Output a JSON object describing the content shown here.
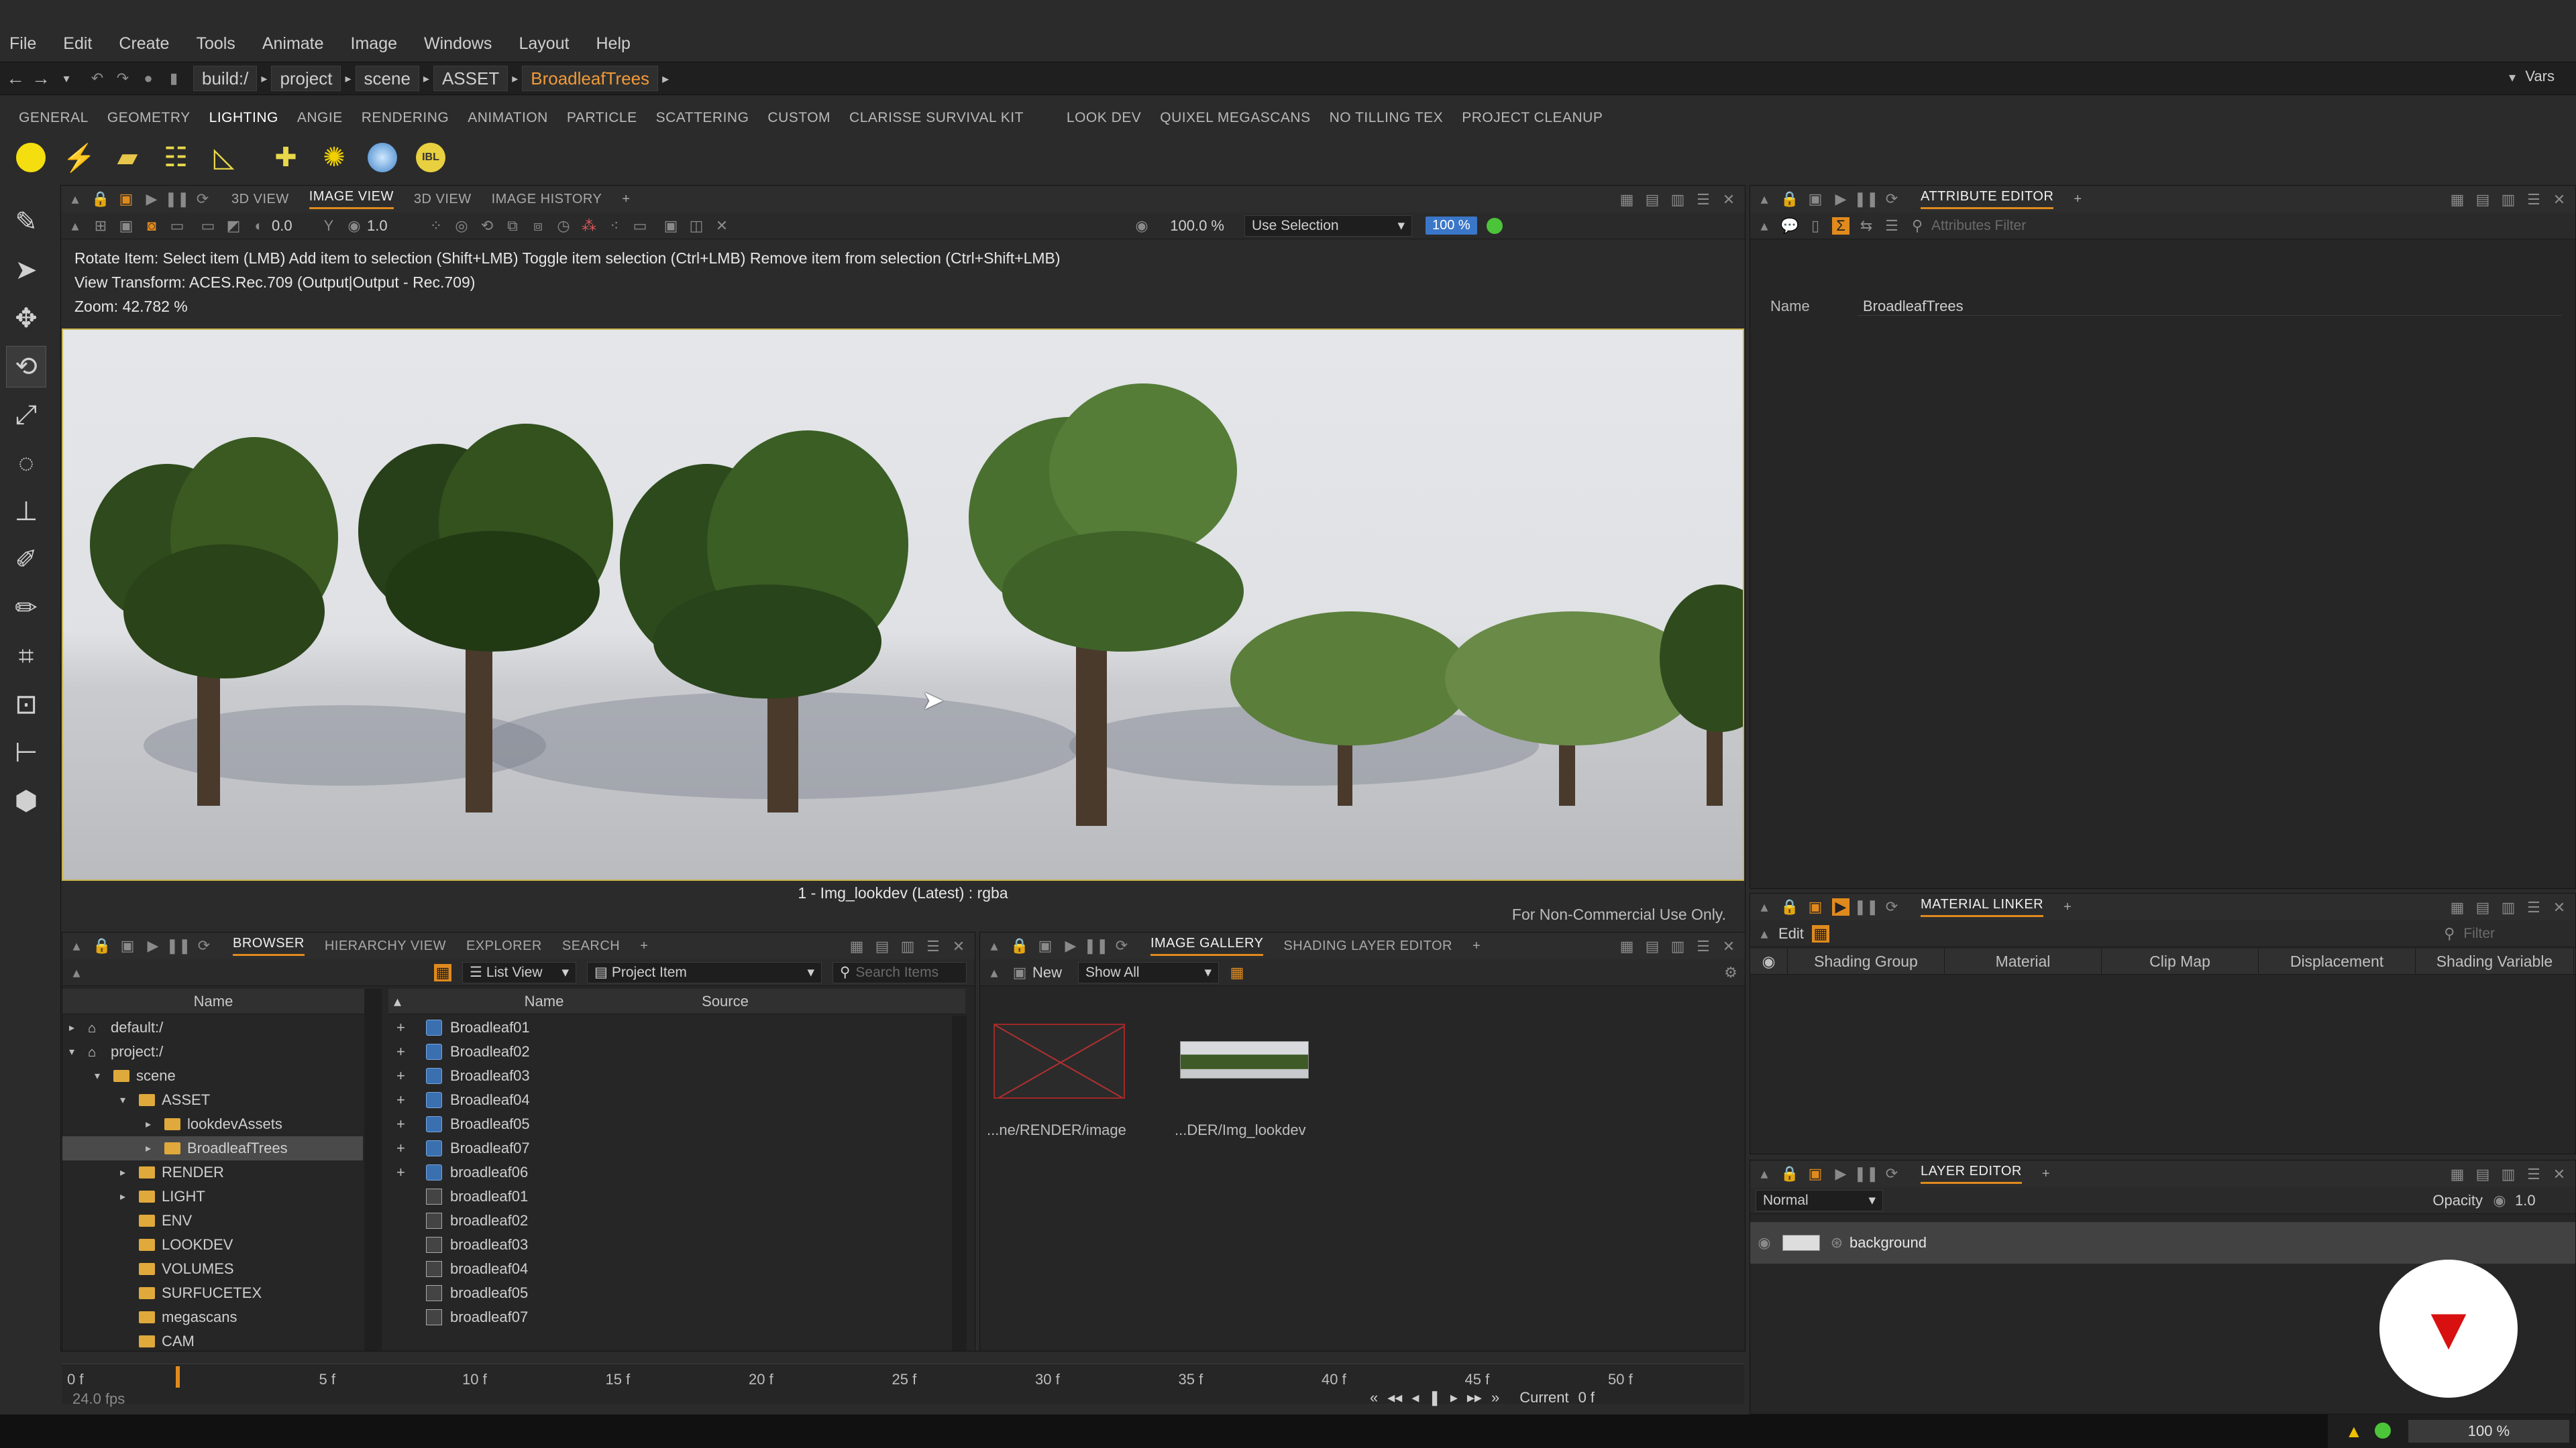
{
  "menu": [
    "File",
    "Edit",
    "Create",
    "Tools",
    "Animate",
    "Image",
    "Windows",
    "Layout",
    "Help"
  ],
  "address": {
    "crumbs": [
      "build:/",
      "project",
      "scene",
      "ASSET"
    ],
    "current": "BroadleafTrees",
    "right": "Vars"
  },
  "shelf_tabs": [
    "GENERAL",
    "GEOMETRY",
    "LIGHTING",
    "ANGIE",
    "RENDERING",
    "ANIMATION",
    "PARTICLE",
    "SCATTERING",
    "CUSTOM",
    "CLARISSE SURVIVAL KIT",
    "LOOK DEV",
    "QUIXEL MEGASCANS",
    "NO TILLING TEX",
    "PROJECT CLEANUP"
  ],
  "shelf_active": "LIGHTING",
  "viewer": {
    "tabs": [
      "3D VIEW",
      "IMAGE VIEW",
      "3D VIEW",
      "IMAGE HISTORY"
    ],
    "active_tab": "IMAGE VIEW",
    "exposure": "0.0",
    "gamma": "1.0",
    "zoom_field": "100.0 %",
    "selection_mode": "Use Selection",
    "percent_badge": "100 %",
    "info_line1": "Rotate Item: Select item (LMB)  Add item to selection (Shift+LMB)  Toggle item selection (Ctrl+LMB)  Remove item from selection (Ctrl+Shift+LMB)",
    "info_line2": "View Transform: ACES.Rec.709 (Output|Output - Rec.709)",
    "info_line3": "Zoom: 42.782 %",
    "caption": "1 - Img_lookdev (Latest) : rgba",
    "watermark": "For Non-Commercial Use Only."
  },
  "attribute_editor": {
    "tab": "ATTRIBUTE EDITOR",
    "filter_placeholder": "Attributes Filter",
    "name_label": "Name",
    "name_value": "BroadleafTrees"
  },
  "material_linker": {
    "tab": "MATERIAL LINKER",
    "edit_label": "Edit",
    "filter_placeholder": "Filter",
    "columns": [
      "Shading Group",
      "Material",
      "Clip Map",
      "Displacement",
      "Shading Variable"
    ]
  },
  "layer_editor": {
    "tab": "LAYER EDITOR",
    "blend_mode": "Normal",
    "opacity_label": "Opacity",
    "opacity_value": "1.0",
    "layer_name": "background"
  },
  "browser": {
    "tabs": [
      "BROWSER",
      "HIERARCHY VIEW",
      "EXPLORER",
      "SEARCH"
    ],
    "active_tab": "BROWSER",
    "view_mode": "List View",
    "filter_type": "Project Item",
    "search_placeholder": "Search Items",
    "tree_header": "Name",
    "tree": [
      {
        "label": "default:/",
        "indent": 0,
        "kind": "ctx"
      },
      {
        "label": "project:/",
        "indent": 0,
        "kind": "ctx"
      },
      {
        "label": "scene",
        "indent": 1,
        "kind": "folder"
      },
      {
        "label": "ASSET",
        "indent": 2,
        "kind": "folder"
      },
      {
        "label": "lookdevAssets",
        "indent": 3,
        "kind": "folder"
      },
      {
        "label": "BroadleafTrees",
        "indent": 3,
        "kind": "folder",
        "selected": true
      },
      {
        "label": "RENDER",
        "indent": 2,
        "kind": "folder"
      },
      {
        "label": "LIGHT",
        "indent": 2,
        "kind": "folder"
      },
      {
        "label": "ENV",
        "indent": 2,
        "kind": "folder"
      },
      {
        "label": "LOOKDEV",
        "indent": 2,
        "kind": "folder"
      },
      {
        "label": "VOLUMES",
        "indent": 2,
        "kind": "folder"
      },
      {
        "label": "SURFUCETEX",
        "indent": 2,
        "kind": "folder"
      },
      {
        "label": "megascans",
        "indent": 2,
        "kind": "folder"
      },
      {
        "label": "CAM",
        "indent": 2,
        "kind": "folder"
      }
    ],
    "list_headers": [
      "Name",
      "Source"
    ],
    "items": [
      "Broadleaf01",
      "Broadleaf02",
      "Broadleaf03",
      "Broadleaf04",
      "Broadleaf05",
      "Broadleaf07",
      "broadleaf06",
      "broadleaf01",
      "broadleaf02",
      "broadleaf03",
      "broadleaf04",
      "broadleaf05",
      "broadleaf07"
    ]
  },
  "gallery": {
    "tabs": [
      "IMAGE GALLERY",
      "SHADING LAYER EDITOR"
    ],
    "active_tab": "IMAGE GALLERY",
    "new_label": "New",
    "show_label": "Show All",
    "thumbs": [
      "...ne/RENDER/image",
      "...DER/Img_lookdev"
    ]
  },
  "timeline": {
    "start": "0 f",
    "end": "50 f",
    "ticks": [
      "0 f",
      "5 f",
      "10 f",
      "15 f",
      "20 f",
      "25 f",
      "30 f",
      "35 f",
      "40 f",
      "45 f",
      "50 f"
    ],
    "fps": "24.0 fps",
    "current_label": "Current",
    "current_value": "0 f"
  },
  "status": {
    "zoom": "100 %"
  },
  "colors": {
    "accent": "#e08a1e",
    "selection_border": "#c9b44a",
    "ok_green": "#4cc43a",
    "logo_red": "#d81010"
  }
}
